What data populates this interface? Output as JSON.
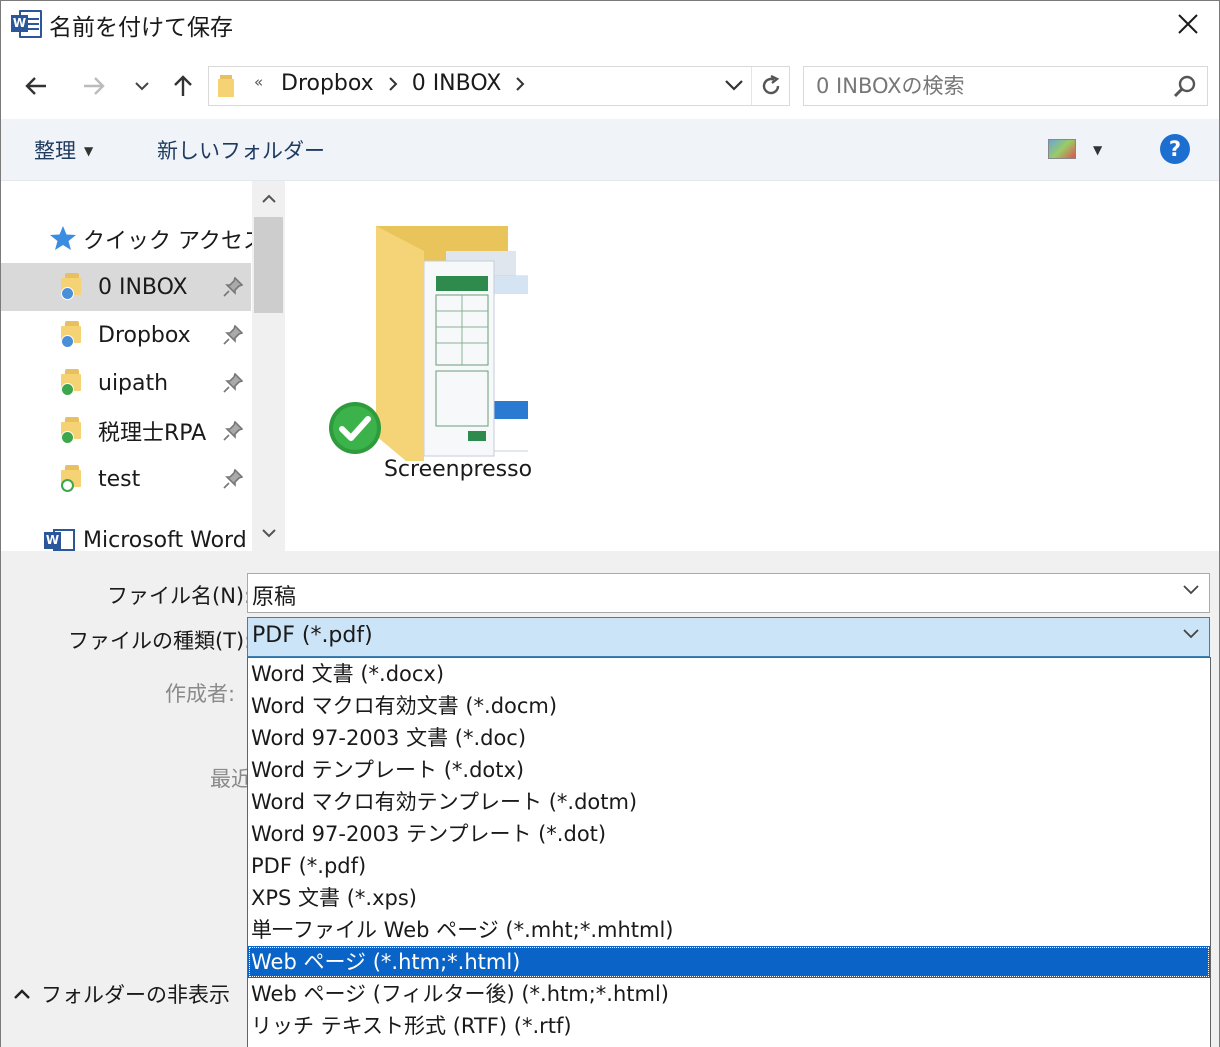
{
  "window": {
    "title": "名前を付けて保存",
    "app_icon_letter": "W",
    "close_icon": "close-icon"
  },
  "navigation": {
    "back_icon": "arrow-left-icon",
    "forward_icon": "arrow-right-icon",
    "recent_icon": "chevron-down-icon",
    "up_icon": "arrow-up-icon"
  },
  "address_bar": {
    "overflow_marker": "«",
    "crumbs": [
      "Dropbox",
      "0 INBOX"
    ],
    "refresh_icon": "refresh-icon"
  },
  "search": {
    "placeholder": "0 INBOXの検索",
    "icon": "search-icon"
  },
  "command_bar": {
    "organize": "整理",
    "new_folder": "新しいフォルダー",
    "help": "?"
  },
  "nav_pane": {
    "quick_access": "クイック アクセス",
    "items": [
      {
        "label": "0 INBOX",
        "status": "sync",
        "selected": true
      },
      {
        "label": "Dropbox",
        "status": "sync",
        "selected": false
      },
      {
        "label": "uipath",
        "status": "ok",
        "selected": false
      },
      {
        "label": "税理士RPA",
        "status": "ok",
        "selected": false
      },
      {
        "label": "test",
        "status": "ok-outline",
        "selected": false
      }
    ],
    "word_item": "Microsoft Word"
  },
  "content": {
    "folders": [
      {
        "name": "Screenpresso",
        "status": "synced"
      }
    ]
  },
  "form": {
    "filename_label": "ファイル名(N):",
    "filename_value": "原稿",
    "filetype_label": "ファイルの種類(T):",
    "filetype_value": "PDF (*.pdf)",
    "author_label": "作成者:",
    "recent_label": "最近"
  },
  "toggle_folders": "フォルダーの非表示",
  "filetype_options": [
    "Word 文書 (*.docx)",
    "Word マクロ有効文書 (*.docm)",
    "Word 97-2003 文書 (*.doc)",
    "Word テンプレート (*.dotx)",
    "Word マクロ有効テンプレート (*.dotm)",
    "Word 97-2003 テンプレート (*.dot)",
    "PDF (*.pdf)",
    "XPS 文書 (*.xps)",
    "単一ファイル Web ページ (*.mht;*.mhtml)",
    "Web ページ (*.htm;*.html)",
    "Web ページ (フィルター後) (*.htm;*.html)",
    "リッチ テキスト形式 (RTF) (*.rtf)"
  ],
  "highlighted_option_index": 9,
  "colors": {
    "highlight": "#0a64c8",
    "selected_field": "#cce4f7",
    "command_bar": "#f0f4f9",
    "help": "#1c6fd1"
  }
}
